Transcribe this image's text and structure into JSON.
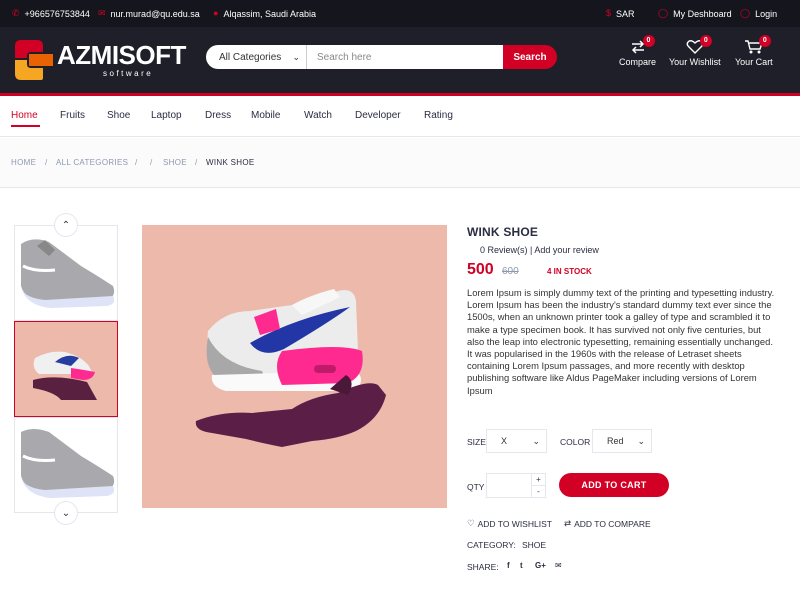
{
  "colors": {
    "accent": "#d10024",
    "topbar": "#15161d",
    "header": "#1e1f29"
  },
  "topbar": {
    "phone": "+966576753844",
    "email": "nur.murad@qu.edu.sa",
    "location": "Alqassim, Saudi Arabia",
    "currency": "SAR",
    "dashboard": "My Deshboard",
    "login": "Login"
  },
  "header": {
    "logo_text": "AZMISOFT",
    "logo_sub": "software",
    "search": {
      "category_selected": "All Categories",
      "placeholder": "Search here",
      "button": "Search"
    },
    "compare": {
      "label": "Compare",
      "count": "0",
      "icon": "compare-icon"
    },
    "wishlist": {
      "label": "Your Wishlist",
      "count": "0",
      "icon": "heart-icon"
    },
    "cart": {
      "label": "Your Cart",
      "count": "0",
      "icon": "cart-icon"
    }
  },
  "nav": [
    "Home",
    "Fruits",
    "Shoe",
    "Laptop",
    "Dress",
    "Mobile",
    "Watch",
    "Developer",
    "Rating"
  ],
  "breadcrumb": {
    "home": "HOME",
    "all_categories": "ALL CATEGORIES",
    "sep": "/",
    "category": "SHOE",
    "current": "WINK SHOE"
  },
  "product": {
    "name": "WINK SHOE",
    "reviews": "0 Review(s) | Add your review",
    "price": "500",
    "old_price": "600",
    "stock": "4 IN STOCK",
    "description": "Lorem Ipsum is simply dummy text of the printing and typesetting industry. Lorem Ipsum has been the industry's standard dummy text ever since the 1500s, when an unknown printer took a galley of type and scrambled it to make a type specimen book. It has survived not only five centuries, but also the leap into electronic typesetting, remaining essentially unchanged. It was popularised in the 1960s with the release of Letraset sheets containing Lorem Ipsum passages, and more recently with desktop publishing software like Aldus PageMaker including versions of Lorem Ipsum",
    "size_label": "SIZE",
    "size_value": "X",
    "color_label": "COLOR",
    "color_value": "Red",
    "qty_label": "QTY",
    "qty_up": "+",
    "qty_down": "-",
    "add_to_cart": "ADD TO CART",
    "add_to_wishlist": "ADD TO WISHLIST",
    "add_to_compare": "ADD TO COMPARE",
    "category_label": "CATEGORY:",
    "category_value": "SHOE",
    "share_label": "SHARE:",
    "share_icons": [
      "f",
      "t",
      "G+",
      "mail"
    ]
  }
}
